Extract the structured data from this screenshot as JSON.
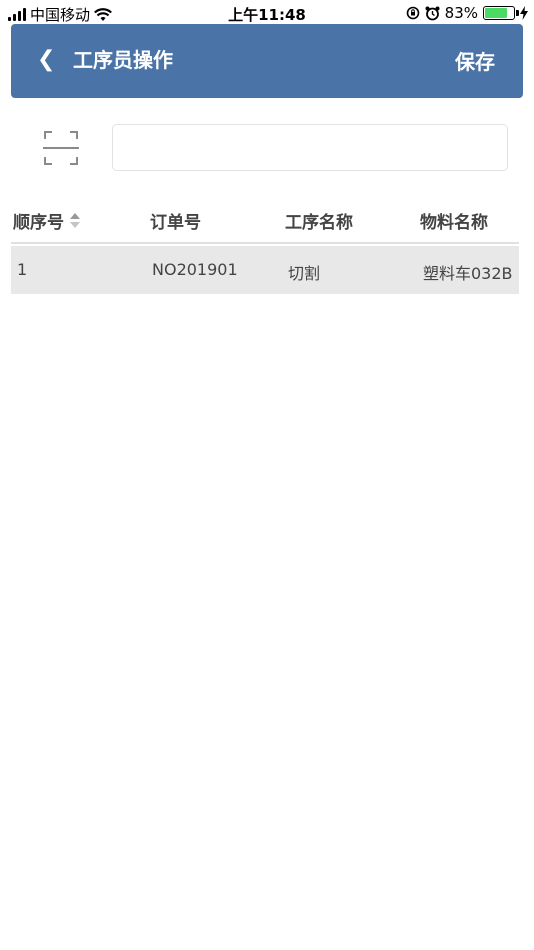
{
  "status_bar": {
    "carrier": "中国移动",
    "time": "上午11:48",
    "battery_percent": "83%",
    "battery_level": 0.83,
    "icons": [
      "signal-icon",
      "wifi-icon",
      "rotation-lock-icon",
      "alarm-icon",
      "battery-icon",
      "charging-icon"
    ]
  },
  "header": {
    "back_icon": "chevron-left-icon",
    "back_glyph": "❮",
    "title": "工序员操作",
    "save_label": "保存",
    "color": "#4a73a8"
  },
  "scan": {
    "icon": "scan-icon",
    "input_value": "",
    "input_placeholder": ""
  },
  "table": {
    "columns": [
      "顺序号",
      "订单号",
      "工序名称",
      "物料名称"
    ],
    "sort_icon": "sort-icon",
    "rows": [
      [
        "1",
        "NO201901",
        "切割",
        "塑料车032B"
      ]
    ],
    "row_bg": "#e8e8e8"
  }
}
